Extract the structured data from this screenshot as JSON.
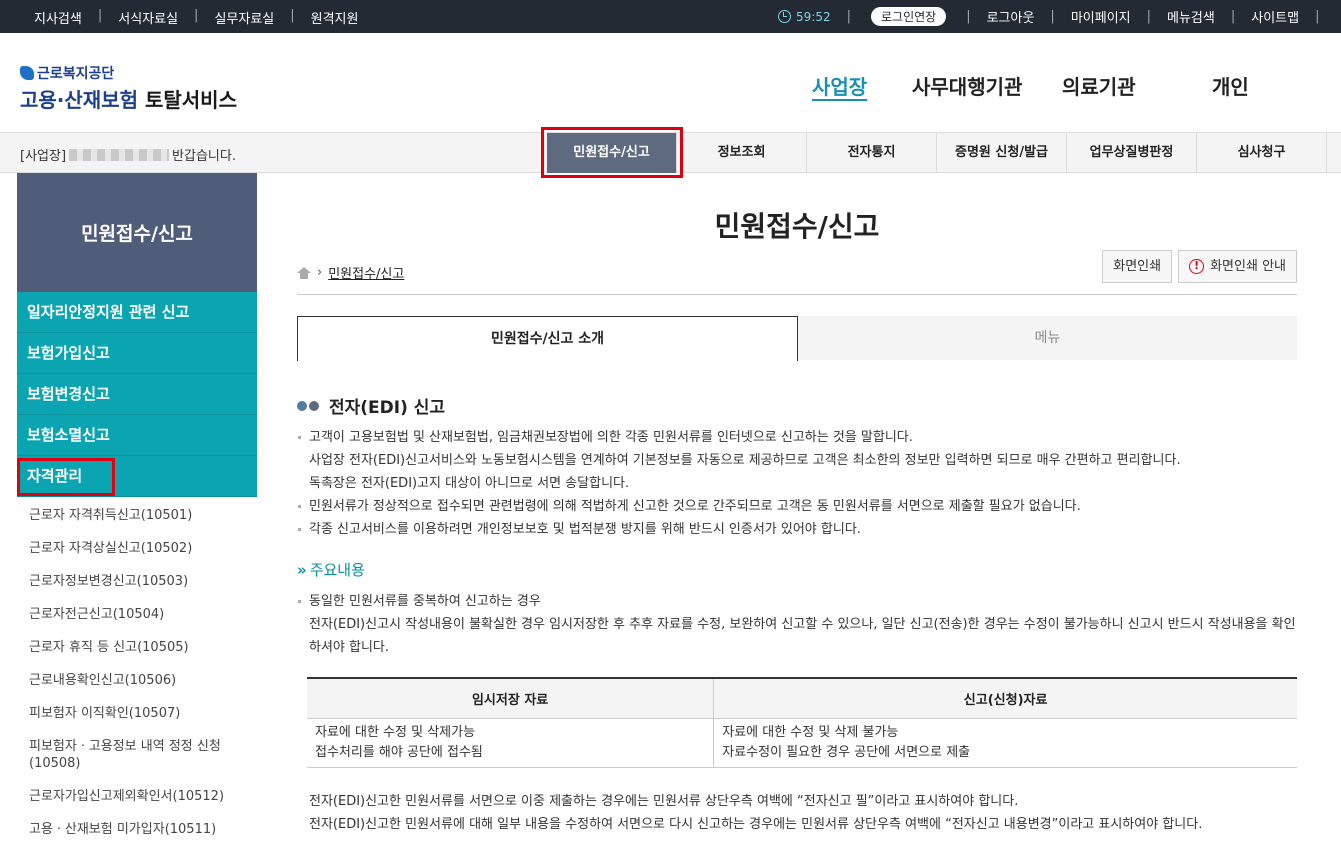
{
  "topbar": {
    "links": [
      "지사검색",
      "서식자료실",
      "실무자료실",
      "원격지원"
    ],
    "timer": "59:52",
    "extend_button": "로그인연장",
    "right_links": [
      "로그아웃",
      "마이페이지",
      "메뉴검색",
      "사이트맵"
    ]
  },
  "logo": {
    "org": "근로복지공단",
    "service_main": "고용·산재보험",
    "service_sub": "토탈서비스"
  },
  "gnb": [
    "사업장",
    "사무대행기관",
    "의료기관",
    "개인"
  ],
  "greeting": {
    "prefix": "[사업장]",
    "suffix": "반갑습니다."
  },
  "menu": [
    "민원접수/신고",
    "정보조회",
    "전자통지",
    "증명원 신청/발급",
    "업무상질병판정",
    "심사청구"
  ],
  "sidebar": {
    "title": "민원접수/신고",
    "categories": [
      "일자리안정지원 관련 신고",
      "보험가입신고",
      "보험변경신고",
      "보험소멸신고",
      "자격관리"
    ],
    "subitems": [
      "근로자 자격취득신고(10501)",
      "근로자 자격상실신고(10502)",
      "근로자정보변경신고(10503)",
      "근로자전근신고(10504)",
      "근로자 휴직 등 신고(10505)",
      "근로내용확인신고(10506)",
      "피보험자 이직확인(10507)",
      "피보험자ㆍ고용정보 내역 정정 신청(10508)",
      "근로자가입신고제외확인서(10512)",
      "고용ㆍ산재보험 미가입자(10511)"
    ]
  },
  "page": {
    "title": "민원접수/신고",
    "breadcrumb": "민원접수/신고",
    "print_button": "화면인쇄",
    "print_guide_button": "화면인쇄 안내",
    "tabs": [
      "민원접수/신고 소개",
      "메뉴"
    ]
  },
  "content": {
    "heading": "전자(EDI) 신고",
    "p1": "고객이 고용보험법 및 산재보험법, 임금채권보장법에 의한 각종 민원서류를 인터넷으로 신고하는 것을 말합니다.",
    "p1b": "사업장 전자(EDI)신고서비스와 노동보험시스템을 연계하여 기본정보를 자동으로 제공하므로 고객은 최소한의 정보만 입력하면 되므로 매우 간편하고 편리합니다.",
    "p1c": "독촉장은 전자(EDI)고지 대상이 아니므로 서면 송달합니다.",
    "p2": "민원서류가 정상적으로 접수되면 관련법령에 의해 적법하게 신고한 것으로 간주되므로 고객은 동 민원서류를 서면으로 제출할 필요가 없습니다.",
    "p3": "각종 신고서비스를 이용하려면 개인정보보호 및 법적분쟁 방지를 위해 반드시 인증서가 있어야 합니다.",
    "subheading": "주요내용",
    "q1": "동일한 민원서류를 중복하여 신고하는 경우",
    "q1b": "전자(EDI)신고시 작성내용이 불확실한 경우 임시저장한 후 추후 자료를 수정, 보완하여 신고할 수 있으나, 일단 신고(전송)한 경우는 수정이 불가능하니 신고시 반드시 작성내용을 확인하셔야 합니다.",
    "table": {
      "headers": [
        "임시저장 자료",
        "신고(신청)자료"
      ],
      "left": [
        "자료에 대한 수정 및 삭제가능",
        "접수처리를 해야 공단에 접수됨"
      ],
      "right": [
        "자료에 대한 수정 및 삭제 불가능",
        "자료수정이 필요한 경우 공단에 서면으로 제출"
      ]
    },
    "n1": "전자(EDI)신고한 민원서류를 서면으로 이중 제출하는 경우에는 민원서류 상단우측 여백에 “전자신고 필”이라고 표시하여야 합니다.",
    "n2": "전자(EDI)신고한 민원서류에 대해 일부 내용을 수정하여 서면으로 다시 신고하는 경우에는 민원서류 상단우측 여백에 “전자신고 내용변경”이라고 표시하여야 합니다."
  },
  "colors": {
    "topbar": "#232a34",
    "sidebar_head": "#4f5d78",
    "sidebar_cat": "#0aa5b0",
    "menu_active": "#5e6b7e",
    "highlight": "#e10010"
  }
}
